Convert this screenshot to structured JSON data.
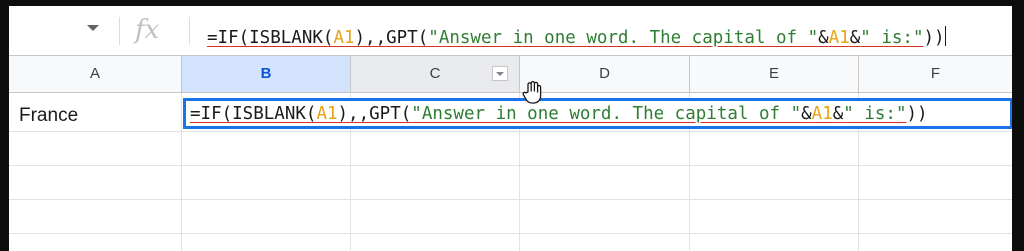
{
  "formula_bar": {
    "fx_label": "fx",
    "formula_parts": [
      {
        "text": "=IF(ISBLANK(",
        "kind": "fn"
      },
      {
        "text": "A1",
        "kind": "ref"
      },
      {
        "text": "),,GPT(",
        "kind": "fn"
      },
      {
        "text": "\"Answer in one word. The capital of \"",
        "kind": "str"
      },
      {
        "text": "&",
        "kind": "fn"
      },
      {
        "text": "A1",
        "kind": "ref"
      },
      {
        "text": "&",
        "kind": "fn"
      },
      {
        "text": "\" is:\"",
        "kind": "str"
      },
      {
        "text": "))",
        "kind": "fn"
      }
    ]
  },
  "columns": [
    {
      "label": "A"
    },
    {
      "label": "B"
    },
    {
      "label": "C"
    },
    {
      "label": "D"
    },
    {
      "label": "E"
    },
    {
      "label": "F"
    }
  ],
  "cells": {
    "a1": "France"
  },
  "colors": {
    "selection_border": "#1a73e8",
    "cell_reference": "#e8a317",
    "string_literal": "#2e7d32",
    "spell_underline": "#d93025"
  },
  "icons": {
    "cursor": "hand-cursor-icon",
    "name_box": "chevron-down-icon",
    "column_menu": "column-dropdown-icon"
  }
}
